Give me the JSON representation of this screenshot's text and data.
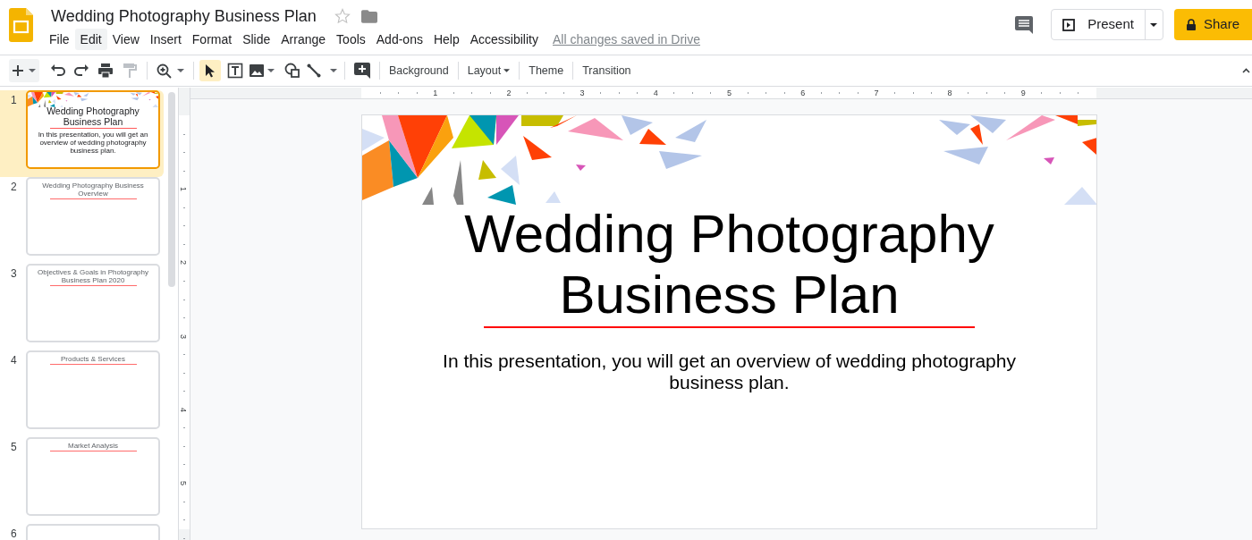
{
  "document": {
    "title": "Wedding Photography Business Plan",
    "starred": false
  },
  "menu": [
    {
      "label": "File",
      "selected": false
    },
    {
      "label": "Edit",
      "selected": true
    },
    {
      "label": "View",
      "selected": false
    },
    {
      "label": "Insert",
      "selected": false
    },
    {
      "label": "Format",
      "selected": false
    },
    {
      "label": "Slide",
      "selected": false
    },
    {
      "label": "Arrange",
      "selected": false
    },
    {
      "label": "Tools",
      "selected": false
    },
    {
      "label": "Add-ons",
      "selected": false
    },
    {
      "label": "Help",
      "selected": false
    },
    {
      "label": "Accessibility",
      "selected": false
    }
  ],
  "save_status": "All changes saved in Drive",
  "header_buttons": {
    "present": "Present",
    "share": "Share"
  },
  "toolbar": {
    "select_tool_selected": true,
    "text_buttons": [
      {
        "label": "Background",
        "dropdown": false
      },
      {
        "label": "Layout",
        "dropdown": true
      },
      {
        "label": "Theme",
        "dropdown": false
      },
      {
        "label": "Transition",
        "dropdown": false
      }
    ]
  },
  "slides": [
    {
      "number": "1",
      "kind": "title",
      "selected": true,
      "title": "Wedding Photography Business Plan",
      "subtitle": "In this presentation, you will get an overview of wedding photography business plan."
    },
    {
      "number": "2",
      "kind": "heading",
      "selected": false,
      "title": "Wedding Photography Business Overview"
    },
    {
      "number": "3",
      "kind": "heading",
      "selected": false,
      "title": "Objectives & Goals in Photography Business Plan 2020"
    },
    {
      "number": "4",
      "kind": "heading",
      "selected": false,
      "title": "Products & Services"
    },
    {
      "number": "5",
      "kind": "heading",
      "selected": false,
      "title": "Market Analysis"
    },
    {
      "number": "6",
      "kind": "cut",
      "selected": false
    }
  ],
  "ruler": {
    "horizontal": [
      "1",
      "2",
      "3",
      "4",
      "5",
      "6",
      "7",
      "8",
      "9"
    ],
    "vertical": [
      "1",
      "2",
      "3",
      "4",
      "5"
    ]
  },
  "current_slide": {
    "title_lines": [
      "Wedding Photography",
      "Business Plan"
    ],
    "subtitle": "In this presentation, you will get an overview of wedding photography business plan."
  }
}
